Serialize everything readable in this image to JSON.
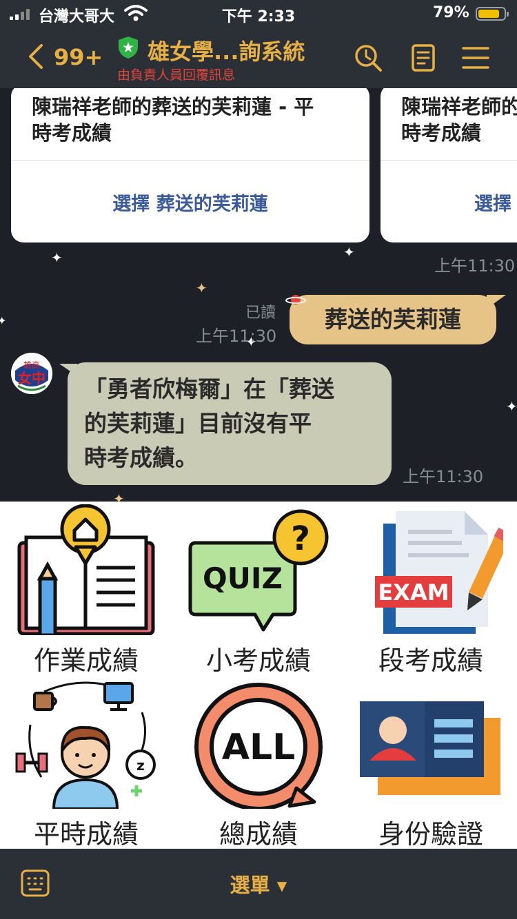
{
  "status_bar": {
    "carrier": "台灣大哥大",
    "time": "下午 2:33",
    "battery": "79%"
  },
  "header": {
    "back_count": "99+",
    "title": "雄女學...詢系統",
    "subtitle": "由負責人員回覆訊息"
  },
  "chat": {
    "cards": [
      {
        "title_line1": "陳瑞祥老師的葬送的芙莉蓮 - 平",
        "title_line2": "時考成績",
        "action": "選擇 葬送的芙莉蓮"
      },
      {
        "title_line1": "陳瑞祥老師的",
        "title_line2": "時考成績",
        "action": "選擇"
      }
    ],
    "card_time": "上午11:30",
    "outgoing": {
      "read": "已讀",
      "time": "上午11:30",
      "text": "葬送的芙莉蓮"
    },
    "incoming": {
      "line1": "「勇者欣梅爾」在「葬送",
      "line2": "的芙莉蓮」目前沒有平",
      "line3": "時考成績。",
      "time": "上午11:30"
    }
  },
  "rich_menu": {
    "items": [
      {
        "label": "作業成績",
        "icon": "homework-book-icon"
      },
      {
        "label": "小考成績",
        "icon": "quiz-bubble-icon"
      },
      {
        "label": "段考成績",
        "icon": "exam-paper-icon"
      },
      {
        "label": "平時成績",
        "icon": "daily-student-icon"
      },
      {
        "label": "總成績",
        "icon": "all-cycle-icon"
      },
      {
        "label": "身份驗證",
        "icon": "id-card-icon"
      }
    ],
    "quiz_text": "QUIZ",
    "exam_text": "EXAM",
    "all_text": "ALL"
  },
  "bottom_bar": {
    "menu_label": "選單 ▾"
  },
  "colors": {
    "accent": "#e6b045",
    "header_bg": "#2b2f36",
    "chat_bg": "#1d2127",
    "outgoing_bubble": "#e6c387",
    "incoming_bubble": "#c9cbb5",
    "subtitle_red": "#e0453a"
  }
}
